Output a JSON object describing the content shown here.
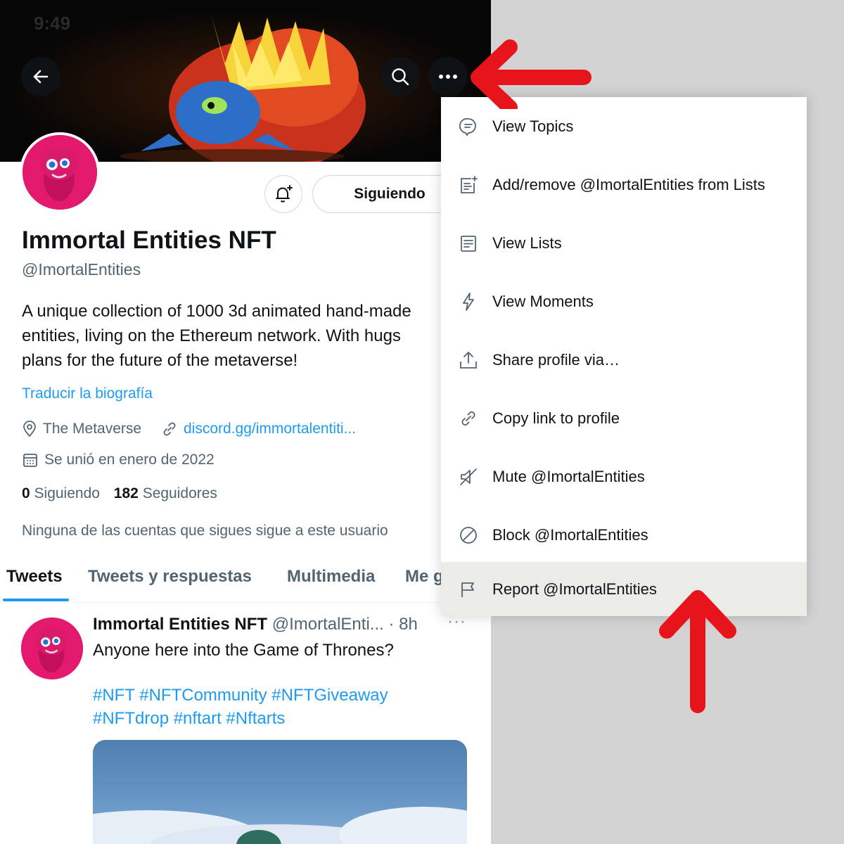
{
  "status_bar": {
    "time": "9:49"
  },
  "profile": {
    "name": "Immortal Entities NFT",
    "handle": "@ImortalEntities",
    "bio_lines": [
      "A unique collection of 1000 3d animated hand-made",
      "entities, living on the Ethereum network. With hugs",
      "plans for the future of the metaverse!"
    ],
    "translate_label": "Traducir la biografía",
    "location": "The Metaverse",
    "link": "discord.gg/immortalentiti...",
    "joined": "Se unió en enero de 2022",
    "following_count": "0",
    "following_label": "Siguiendo",
    "followers_count": "182",
    "followers_label": "Seguidores",
    "followers_note": "Ninguna de las cuentas que sigues sigue a este usuario",
    "follow_button_label": "Siguiendo"
  },
  "tabs": [
    {
      "label": "Tweets",
      "active": true
    },
    {
      "label": "Tweets y respuestas"
    },
    {
      "label": "Multimedia"
    },
    {
      "label": "Me g"
    }
  ],
  "tweet": {
    "author": "Immortal Entities NFT",
    "handle": "@ImortalEnti...",
    "time": "· 8h",
    "more": "···",
    "text": "Anyone here into the Game of Thrones?",
    "hashtags_line1": "#NFT #NFTCommunity #NFTGiveaway",
    "hashtags_line2": "#NFTdrop #nftart #Nftarts"
  },
  "menu": {
    "items": [
      {
        "label": "View Topics",
        "icon": "topics-icon"
      },
      {
        "label": "Add/remove @ImortalEntities from Lists",
        "icon": "list-add-icon"
      },
      {
        "label": "View Lists",
        "icon": "list-icon"
      },
      {
        "label": "View Moments",
        "icon": "lightning-icon"
      },
      {
        "label": "Share profile via…",
        "icon": "share-icon"
      },
      {
        "label": "Copy link to profile",
        "icon": "link-icon"
      },
      {
        "label": "Mute @ImortalEntities",
        "icon": "mute-icon"
      },
      {
        "label": "Block @ImortalEntities",
        "icon": "block-icon"
      },
      {
        "label": "Report @ImortalEntities",
        "icon": "flag-icon",
        "highlighted": true
      }
    ]
  },
  "colors": {
    "accent": "#1d9bf0",
    "annotation_arrow": "#e8141c",
    "avatar_bg": "#e3196e",
    "highlight_row": "#ebebe8"
  }
}
